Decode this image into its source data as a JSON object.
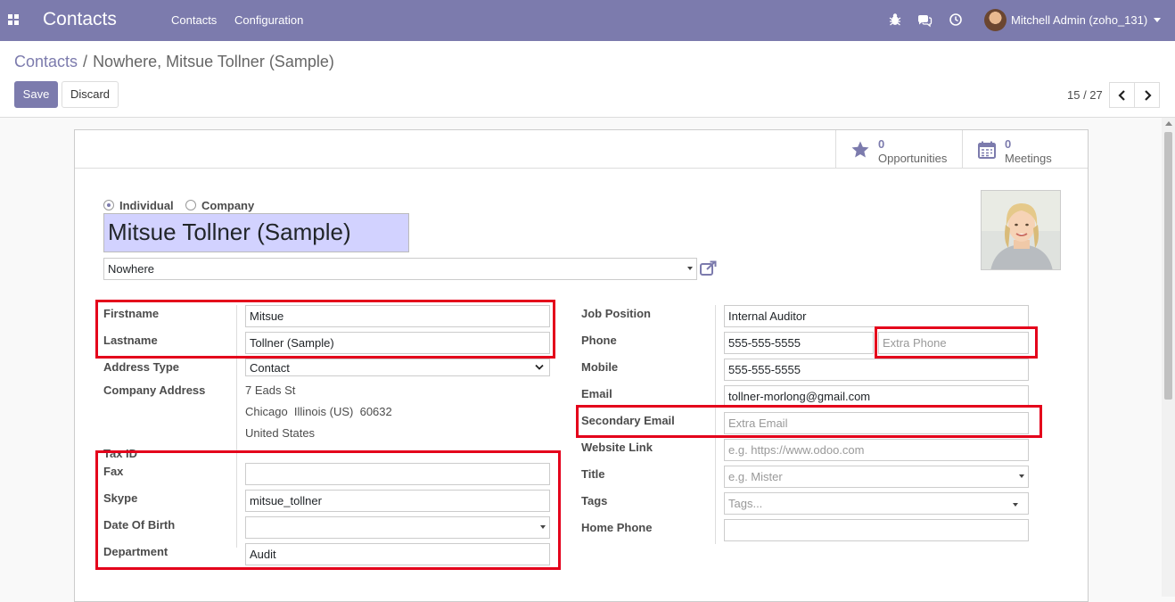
{
  "navbar": {
    "app_name": "Contacts",
    "menu": [
      "Contacts",
      "Configuration"
    ],
    "user_name": "Mitchell Admin (zoho_131)",
    "accent_color": "#7c7bad"
  },
  "breadcrumb": {
    "parent": "Contacts",
    "separator": "/",
    "current": "Nowhere, Mitsue Tollner (Sample)"
  },
  "actions": {
    "save_label": "Save",
    "discard_label": "Discard"
  },
  "pager": {
    "value": "15 / 27"
  },
  "smart_buttons": [
    {
      "count": "0",
      "label": "Opportunities",
      "icon": "star-icon"
    },
    {
      "count": "0",
      "label": "Meetings",
      "icon": "calendar-icon"
    }
  ],
  "company_type": {
    "options": [
      "Individual",
      "Company"
    ],
    "selected": "Individual"
  },
  "contact": {
    "name": "Mitsue Tollner (Sample)",
    "parent_company": "Nowhere"
  },
  "left_fields": {
    "firstname": {
      "label": "Firstname",
      "value": "Mitsue"
    },
    "lastname": {
      "label": "Lastname",
      "value": "Tollner (Sample)"
    },
    "address_type": {
      "label": "Address Type",
      "value": "Contact"
    },
    "company_address": {
      "label": "Company Address",
      "street": "7 Eads St",
      "city_line": "Chicago  Illinois (US)  60632",
      "country": "United States"
    },
    "tax_id": {
      "label": "Tax ID"
    },
    "fax": {
      "label": "Fax",
      "value": ""
    },
    "skype": {
      "label": "Skype",
      "value": "mitsue_tollner"
    },
    "date_of_birth": {
      "label": "Date Of Birth",
      "value": ""
    },
    "department": {
      "label": "Department",
      "value": "Audit"
    }
  },
  "right_fields": {
    "job_position": {
      "label": "Job Position",
      "value": "Internal Auditor"
    },
    "phone": {
      "label": "Phone",
      "value": "555-555-5555",
      "extra_placeholder": "Extra Phone"
    },
    "mobile": {
      "label": "Mobile",
      "value": "555-555-5555"
    },
    "email": {
      "label": "Email",
      "value": "tollner-morlong@gmail.com"
    },
    "secondary_email": {
      "label": "Secondary Email",
      "placeholder": "Extra Email"
    },
    "website": {
      "label": "Website Link",
      "placeholder": "e.g. https://www.odoo.com"
    },
    "title": {
      "label": "Title",
      "placeholder": "e.g. Mister"
    },
    "tags": {
      "label": "Tags",
      "placeholder": "Tags..."
    },
    "home_phone": {
      "label": "Home Phone",
      "value": ""
    }
  },
  "highlight_color": "#e4001b"
}
